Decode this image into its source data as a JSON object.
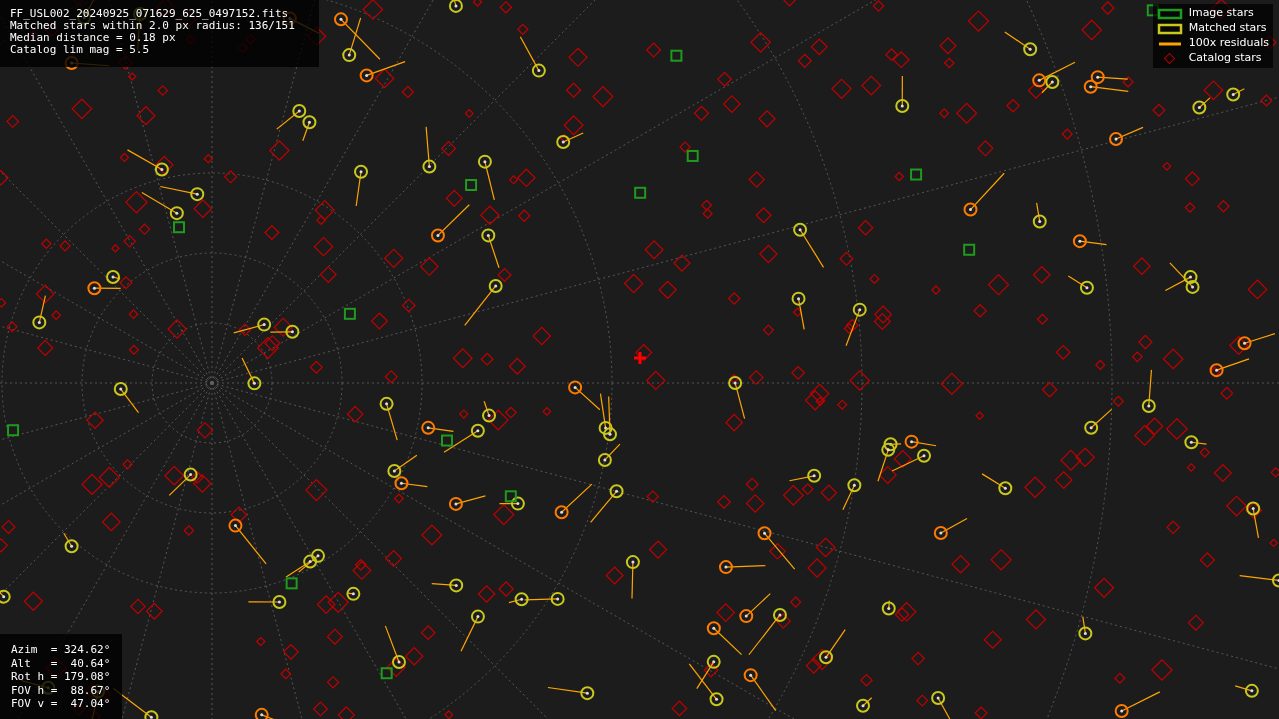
{
  "info": {
    "lines": [
      "FF_USL002_20240925_071629_625_0497152.fits",
      "Matched stars within 2.0 px radius: 136/151",
      "Median distance = 0.18 px",
      "Catalog lim mag = 5.5"
    ]
  },
  "legend": [
    {
      "kind": "box",
      "color": "#1f9a1f",
      "label": "Image stars"
    },
    {
      "kind": "box",
      "color": "#c8c81e",
      "label": "Matched stars"
    },
    {
      "kind": "line",
      "color": "#ffa500",
      "label": "100x residuals"
    },
    {
      "kind": "diamond",
      "color": "#b00000",
      "label": "Catalog stars"
    }
  ],
  "pointing": {
    "lines": [
      "Azim  = 324.62°",
      "Alt   =  40.64°",
      "Rot h = 179.08°",
      "FOV h =  88.67°",
      "FOV v =  47.04°"
    ]
  }
}
